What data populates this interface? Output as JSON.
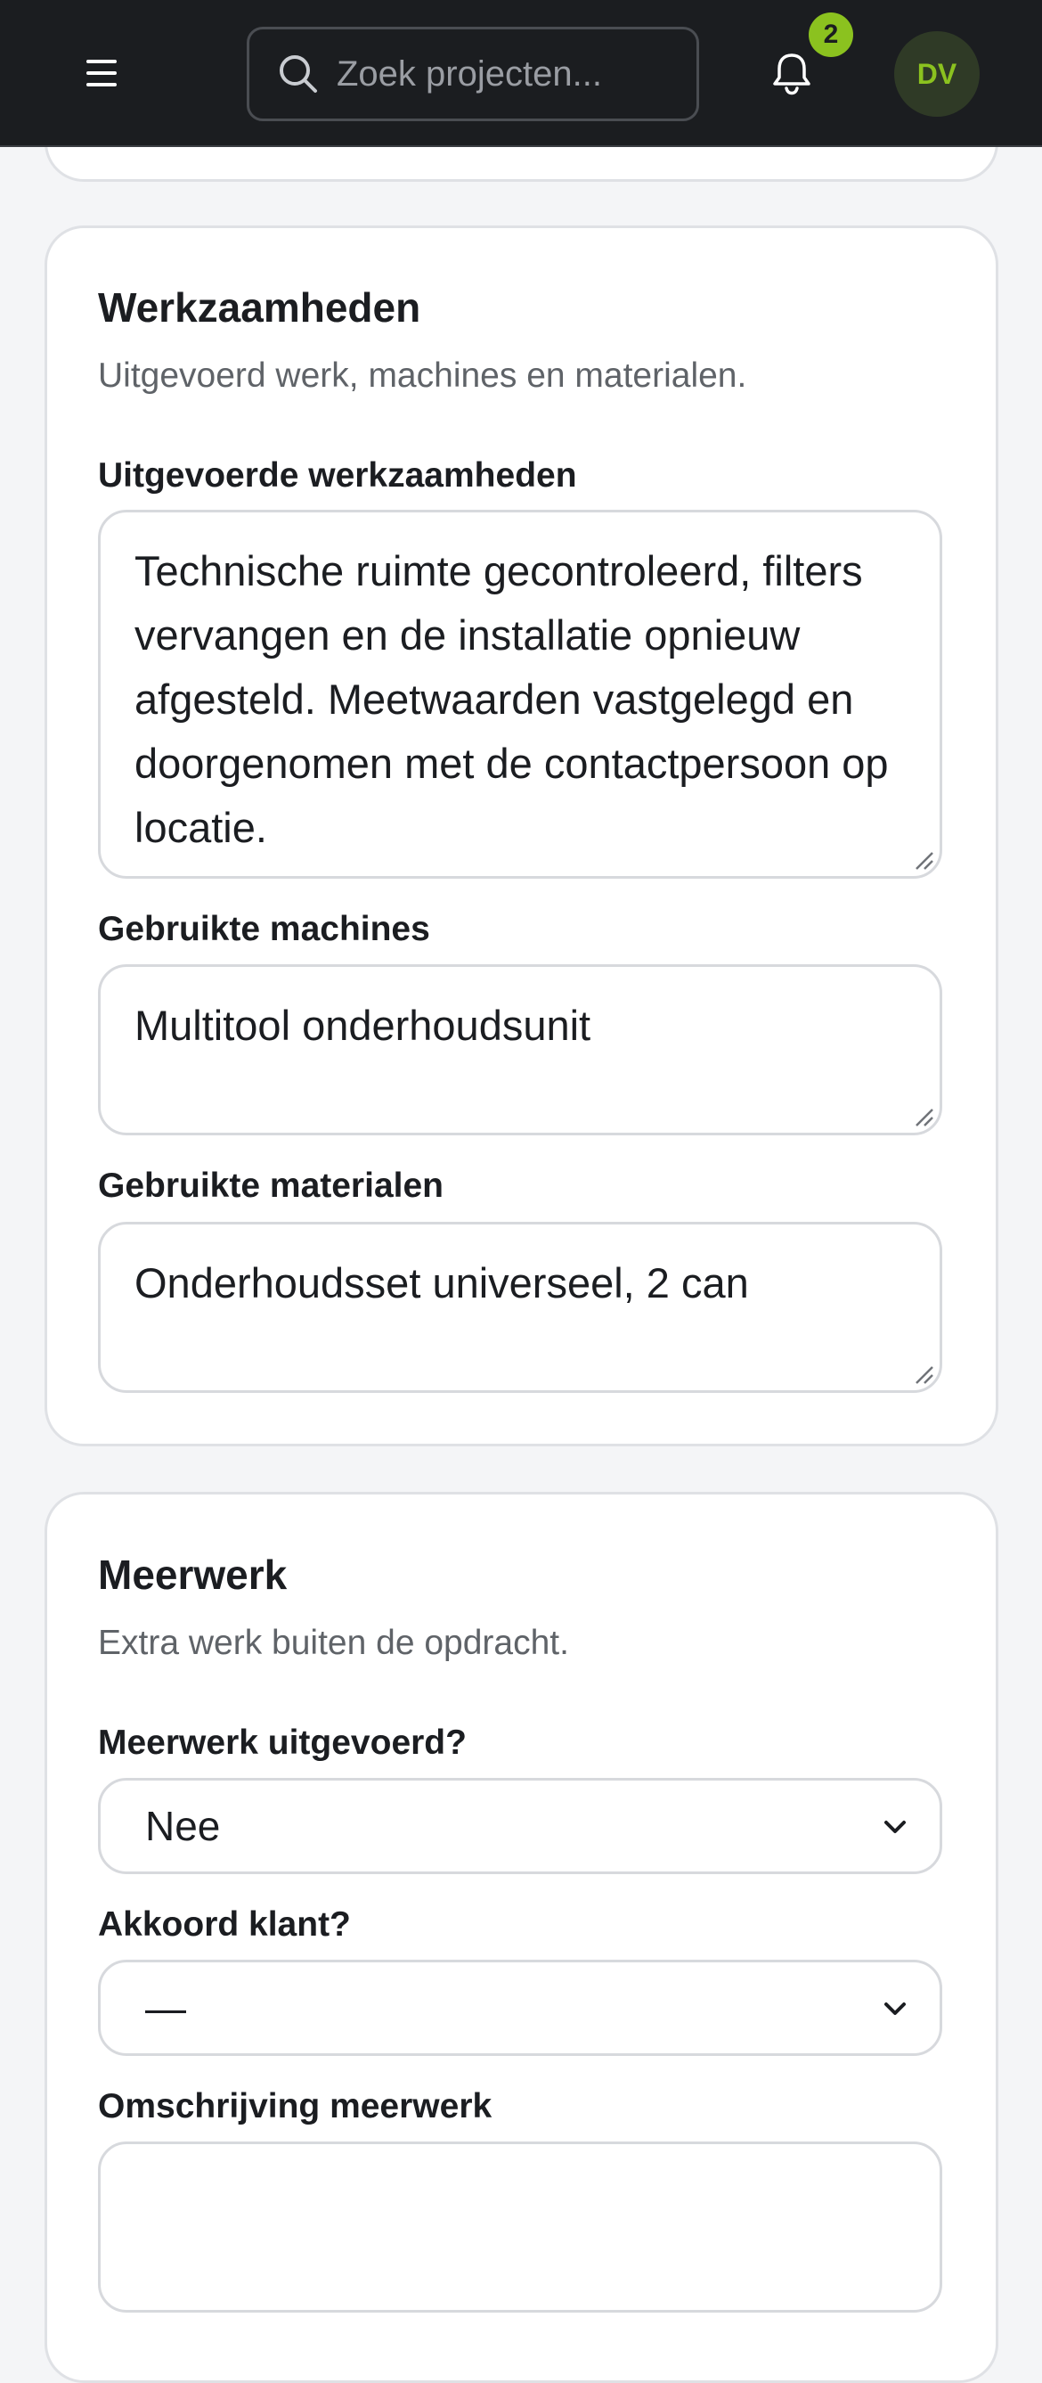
{
  "header": {
    "search_placeholder": "Zoek projecten...",
    "notification_count": "2",
    "avatar_initials": "DV"
  },
  "werkzaamheden": {
    "title": "Werkzaamheden",
    "subtitle": "Uitgevoerd werk, machines en materialen.",
    "uitgevoerd": {
      "label": "Uitgevoerde werkzaamheden",
      "value": "Technische ruimte gecontroleerd, filters vervangen en de installatie opnieuw afgesteld. Meetwaarden vastgelegd en doorgenomen met de contactpersoon op locatie."
    },
    "machines": {
      "label": "Gebruikte machines",
      "value": "Multitool onderhoudsunit"
    },
    "materialen": {
      "label": "Gebruikte materialen",
      "value": "Onderhoudsset universeel, 2 can"
    }
  },
  "meerwerk": {
    "title": "Meerwerk",
    "subtitle": "Extra werk buiten de opdracht.",
    "uitgevoerd": {
      "label": "Meerwerk uitgevoerd?",
      "value": "Nee"
    },
    "akkoord": {
      "label": "Akkoord klant?",
      "value": "—"
    },
    "omschrijving": {
      "label": "Omschrijving meerwerk",
      "value": ""
    }
  },
  "colors": {
    "accent": "#8bc21f",
    "header_bg": "#1b1d20",
    "page_bg": "#f4f5f7"
  },
  "icons": [
    "menu-icon",
    "search-icon",
    "bell-icon",
    "chevron-down-icon",
    "resize-handle-icon"
  ]
}
